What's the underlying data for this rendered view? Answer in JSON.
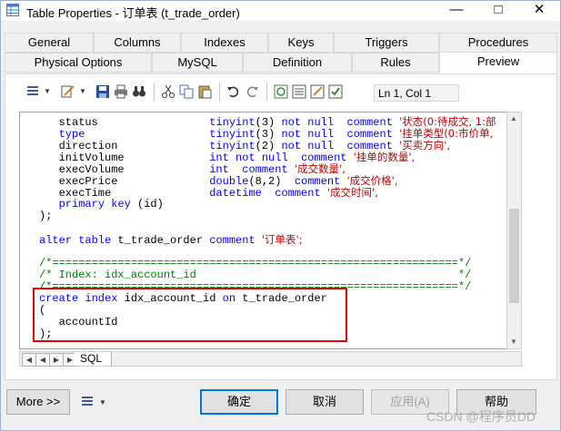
{
  "window": {
    "title": "Table Properties - 订单表 (t_trade_order)"
  },
  "tabs_row1": [
    "General",
    "Columns",
    "Indexes",
    "Keys",
    "Triggers",
    "Procedures"
  ],
  "tabs_row2": [
    "Physical Options",
    "MySQL",
    "Definition",
    "Rules",
    "Preview"
  ],
  "active_tab": "Preview",
  "toolbar": {
    "position_label": "Ln 1, Col 1"
  },
  "editor": {
    "lines": [
      [
        [
          "plain",
          "   status                 "
        ],
        [
          "kw",
          "tinyint"
        ],
        [
          "plain",
          "(3) "
        ],
        [
          "kw",
          "not null"
        ],
        [
          "plain",
          "  "
        ],
        [
          "kw",
          "comment"
        ],
        [
          "plain",
          " "
        ],
        [
          "str",
          "'状态(0:待成交, 1:部"
        ]
      ],
      [
        [
          "plain",
          "   "
        ],
        [
          "kw",
          "type"
        ],
        [
          "plain",
          "                   "
        ],
        [
          "kw",
          "tinyint"
        ],
        [
          "plain",
          "(3) "
        ],
        [
          "kw",
          "not null"
        ],
        [
          "plain",
          "  "
        ],
        [
          "kw",
          "comment"
        ],
        [
          "plain",
          " "
        ],
        [
          "str",
          "'挂单类型(0:市价单,"
        ]
      ],
      [
        [
          "plain",
          "   direction              "
        ],
        [
          "kw",
          "tinyint"
        ],
        [
          "plain",
          "(2) "
        ],
        [
          "kw",
          "not null"
        ],
        [
          "plain",
          "  "
        ],
        [
          "kw",
          "comment"
        ],
        [
          "plain",
          " "
        ],
        [
          "str",
          "'买卖方向',"
        ]
      ],
      [
        [
          "plain",
          "   initVolume             "
        ],
        [
          "kw",
          "int"
        ],
        [
          "plain",
          " "
        ],
        [
          "kw",
          "not null"
        ],
        [
          "plain",
          "  "
        ],
        [
          "kw",
          "comment"
        ],
        [
          "plain",
          " "
        ],
        [
          "str",
          "'挂单的数量',"
        ]
      ],
      [
        [
          "plain",
          "   execVolume             "
        ],
        [
          "kw",
          "int"
        ],
        [
          "plain",
          "  "
        ],
        [
          "kw",
          "comment"
        ],
        [
          "plain",
          " "
        ],
        [
          "str",
          "'成交数量',"
        ]
      ],
      [
        [
          "plain",
          "   execPrice              "
        ],
        [
          "kw",
          "double"
        ],
        [
          "plain",
          "(8,2)  "
        ],
        [
          "kw",
          "comment"
        ],
        [
          "plain",
          " "
        ],
        [
          "str",
          "'成交价格',"
        ]
      ],
      [
        [
          "plain",
          "   execTime               "
        ],
        [
          "kw",
          "datetime"
        ],
        [
          "plain",
          "  "
        ],
        [
          "kw",
          "comment"
        ],
        [
          "plain",
          " "
        ],
        [
          "str",
          "'成交时间',"
        ]
      ],
      [
        [
          "plain",
          "   "
        ],
        [
          "kw",
          "primary key"
        ],
        [
          "plain",
          " (id)"
        ]
      ],
      [
        [
          "plain",
          ");"
        ]
      ],
      [
        [
          "plain",
          ""
        ]
      ],
      [
        [
          "kw",
          "alter table"
        ],
        [
          "plain",
          " t_trade_order "
        ],
        [
          "kw",
          "comment"
        ],
        [
          "plain",
          " "
        ],
        [
          "str",
          "'订单表';"
        ]
      ],
      [
        [
          "plain",
          ""
        ]
      ],
      [
        [
          "cm",
          "/*==============================================================*/"
        ]
      ],
      [
        [
          "cm",
          "/* Index: idx_account_id                                        */"
        ]
      ],
      [
        [
          "cm",
          "/*==============================================================*/"
        ]
      ],
      [
        [
          "kw",
          "create index"
        ],
        [
          "plain",
          " idx_account_id "
        ],
        [
          "kw",
          "on"
        ],
        [
          "plain",
          " t_trade_order"
        ]
      ],
      [
        [
          "plain",
          "("
        ]
      ],
      [
        [
          "plain",
          "   accountId"
        ]
      ],
      [
        [
          "plain",
          ");"
        ]
      ]
    ]
  },
  "bottom_tab": "SQL",
  "buttons": {
    "more": "More >>",
    "ok": "确定",
    "cancel": "取消",
    "apply": "应用(A)",
    "help": "帮助"
  },
  "watermark": "CSDN @程序员DD",
  "colors": {
    "keyword": "#0000ff",
    "string": "#c00000",
    "comment": "#008000",
    "highlight": "#e60000"
  }
}
